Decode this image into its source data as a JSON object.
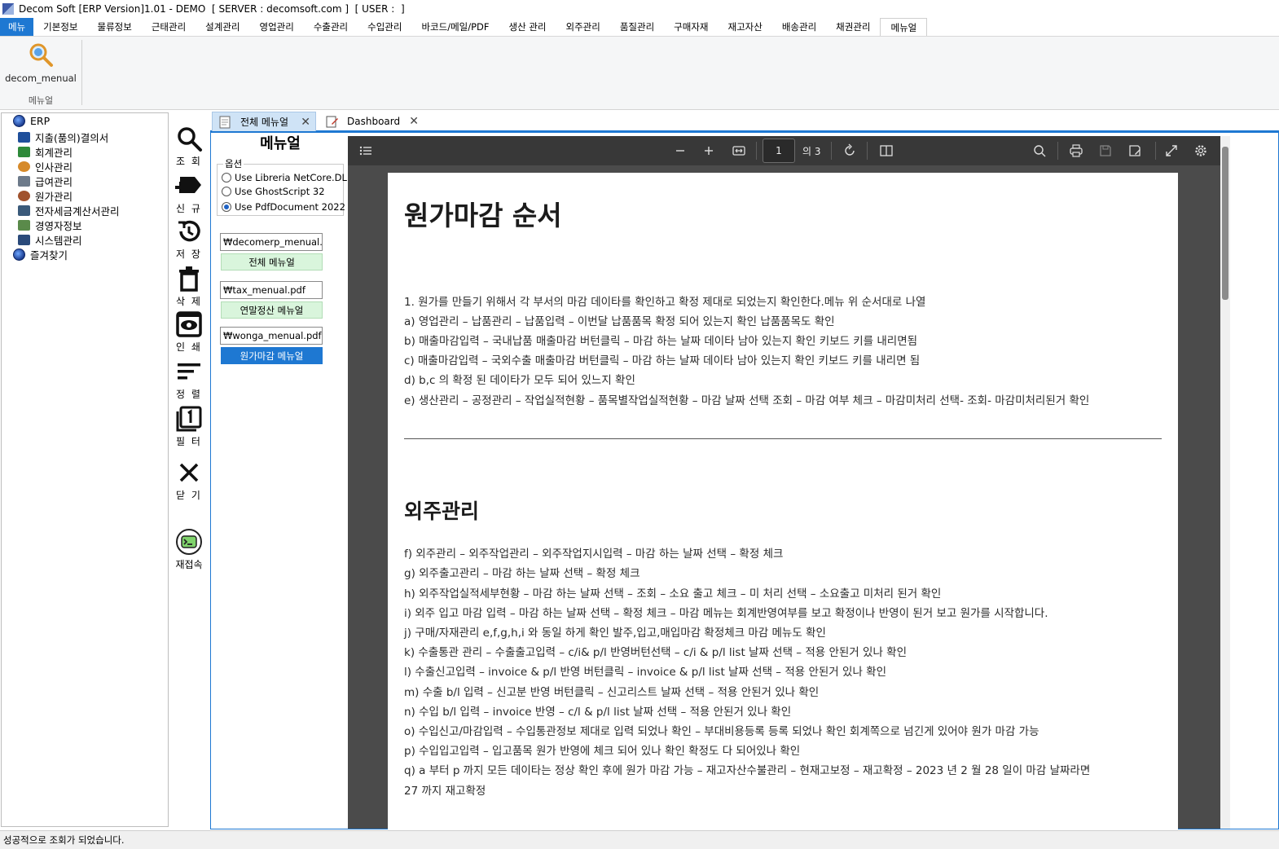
{
  "window": {
    "title": "Decom Soft [ERP Version]1.01 - DEMO  [ SERVER : decomsoft.com ]  [ USER :  ]"
  },
  "menubar": {
    "items": [
      "메뉴",
      "기본정보",
      "물류정보",
      "근태관리",
      "설계관리",
      "영업관리",
      "수출관리",
      "수입관리",
      "바코드/메일/PDF",
      "생산 관리",
      "외주관리",
      "품질관리",
      "구매자재",
      "재고자산",
      "배송관리",
      "채권관리",
      "메뉴얼"
    ]
  },
  "ribbon": {
    "button_label": "decom_menual",
    "group_label": "메뉴얼"
  },
  "tree": {
    "items": [
      "ERP",
      "지출(품의)결의서",
      "회계관리",
      "인사관리",
      "급여관리",
      "원가관리",
      "전자세금계산서관리",
      "경영자정보",
      "시스템관리",
      "즐겨찾기"
    ]
  },
  "toolbar": {
    "search": "조 회",
    "new": "신 규",
    "save": "저 장",
    "delete": "삭 제",
    "print": "인 쇄",
    "sort": "정 렬",
    "filter": "필 터",
    "close": "닫 기",
    "reconnect": "재접속"
  },
  "tabs": {
    "tab1": "전체 메뉴얼",
    "tab2": "Dashboard"
  },
  "manual": {
    "title": "메뉴얼",
    "options_legend": "옵션",
    "option1": "Use  Libreria NetCore.DLL",
    "option2": "Use GhostScript 32",
    "option3": "Use PdfDocument 2022",
    "selected_option": "Use PdfDocument 2022",
    "file1": "₩decomerp_menual.pdf",
    "btn1": "전체 메뉴얼",
    "file2": "₩tax_menual.pdf",
    "btn2": "연말정산 메뉴얼",
    "file3": "₩wonga_menual.pdf",
    "btn3": "원가마감 메뉴얼"
  },
  "pdf": {
    "page": "1",
    "page_total": "의 3",
    "title": "원가마감 순서",
    "lines1": [
      "1. 원가를 만들기 위해서 각 부서의 마감 데이타를 확인하고 확정 제대로 되었는지 확인한다.메뉴 위 순서대로 나열",
      "a) 영업관리 – 납품관리 – 납품입력 – 이번달 납품품목 확정 되어 있는지 확인 납품품목도 확인",
      "b) 매출마감입력 – 국내납품 매출마감 버턴클릭 – 마감 하는 날짜 데이타 남아 있는지 확인 키보드 키를 내리면됨",
      "c) 매출마감입력 – 국외수출 매출마감 버턴클릭 – 마감 하는 날짜 데이타 남아 있는지 확인 키보드 키를 내리면 됨",
      "d) b,c 의 확정 된 데이타가 모두 되어 있느지 확인",
      "e) 생산관리 – 공정관리 – 작업실적현황 – 품목별작업실적현황 – 마감 날짜 선택 조회 – 마감 여부 체크 – 마감미처리 선택- 조회- 마감미처리된거 확인"
    ],
    "heading2": "외주관리",
    "lines2": [
      "f) 외주관리 – 외주작업관리 – 외주작업지시입력 – 마감 하는 날짜 선택 – 확정 체크",
      "g) 외주출고관리 – 마감 하는 날짜 선택 – 확정 체크",
      "h) 외주작업실적세부현황 – 마감 하는 날짜 선택 – 조회 – 소요 출고 체크 – 미 처리 선택 – 소요출고 미처리 된거 확인",
      "i) 외주 입고 마감 입력 – 마감 하는 날짜 선택 – 확정 체크 – 마감 메뉴는 회계반영여부를 보고 확정이나 반영이 된거 보고 원가를 시작합니다.",
      "j) 구매/자재관리 e,f,g,h,i 와 동일 하게 확인 발주,입고,매입마감 확정체크 마감 메뉴도 확인",
      "k) 수출통관 관리 – 수출출고입력 – c/i& p/l 반영버턴선택 – c/i & p/l list 날짜 선택 – 적용 안된거 있나 확인",
      "l) 수출신고입력 – invoice & p/l 반영 버턴클릭 – invoice & p/l list 날짜 선택 – 적용 안된거 있나 확인",
      "m) 수출 b/l 입력 – 신고분 반영 버턴클릭 – 신고리스트 날짜 선택 – 적용 안된거 있나 확인",
      "n) 수입 b/l 입력 – invoice 반영 – c/l & p/l list 날짜 선택 – 적용 안된거 있나 확인",
      "o) 수입신고/마감입력 – 수입통관정보 제대로 입력 되었나 확인 – 부대비용등록 등록 되었나 확인 회계쪽으로 넘긴게 있어야 원가 마감 가능",
      "p) 수입입고입력 – 입고품목 원가 반영에 체크 되어 있나 확인 확정도 다 되어있나 확인",
      "q) a 부터 p 까지 모든 데이타는 정상 확인 후에 원가 마감 가능 – 재고자산수불관리 – 현재고보정 – 재고확정 – 2023 년 2 월 28 일이 마감 날짜라면",
      "27 까지 재고확정"
    ]
  },
  "status": {
    "message": "성공적으로 조회가 되었습니다."
  },
  "colors": {
    "accent": "#1e78d2",
    "pdf_toolbar": "#383838",
    "pdf_bg": "#4b4b4b",
    "menu_button_bg": "#d9f5dc"
  }
}
